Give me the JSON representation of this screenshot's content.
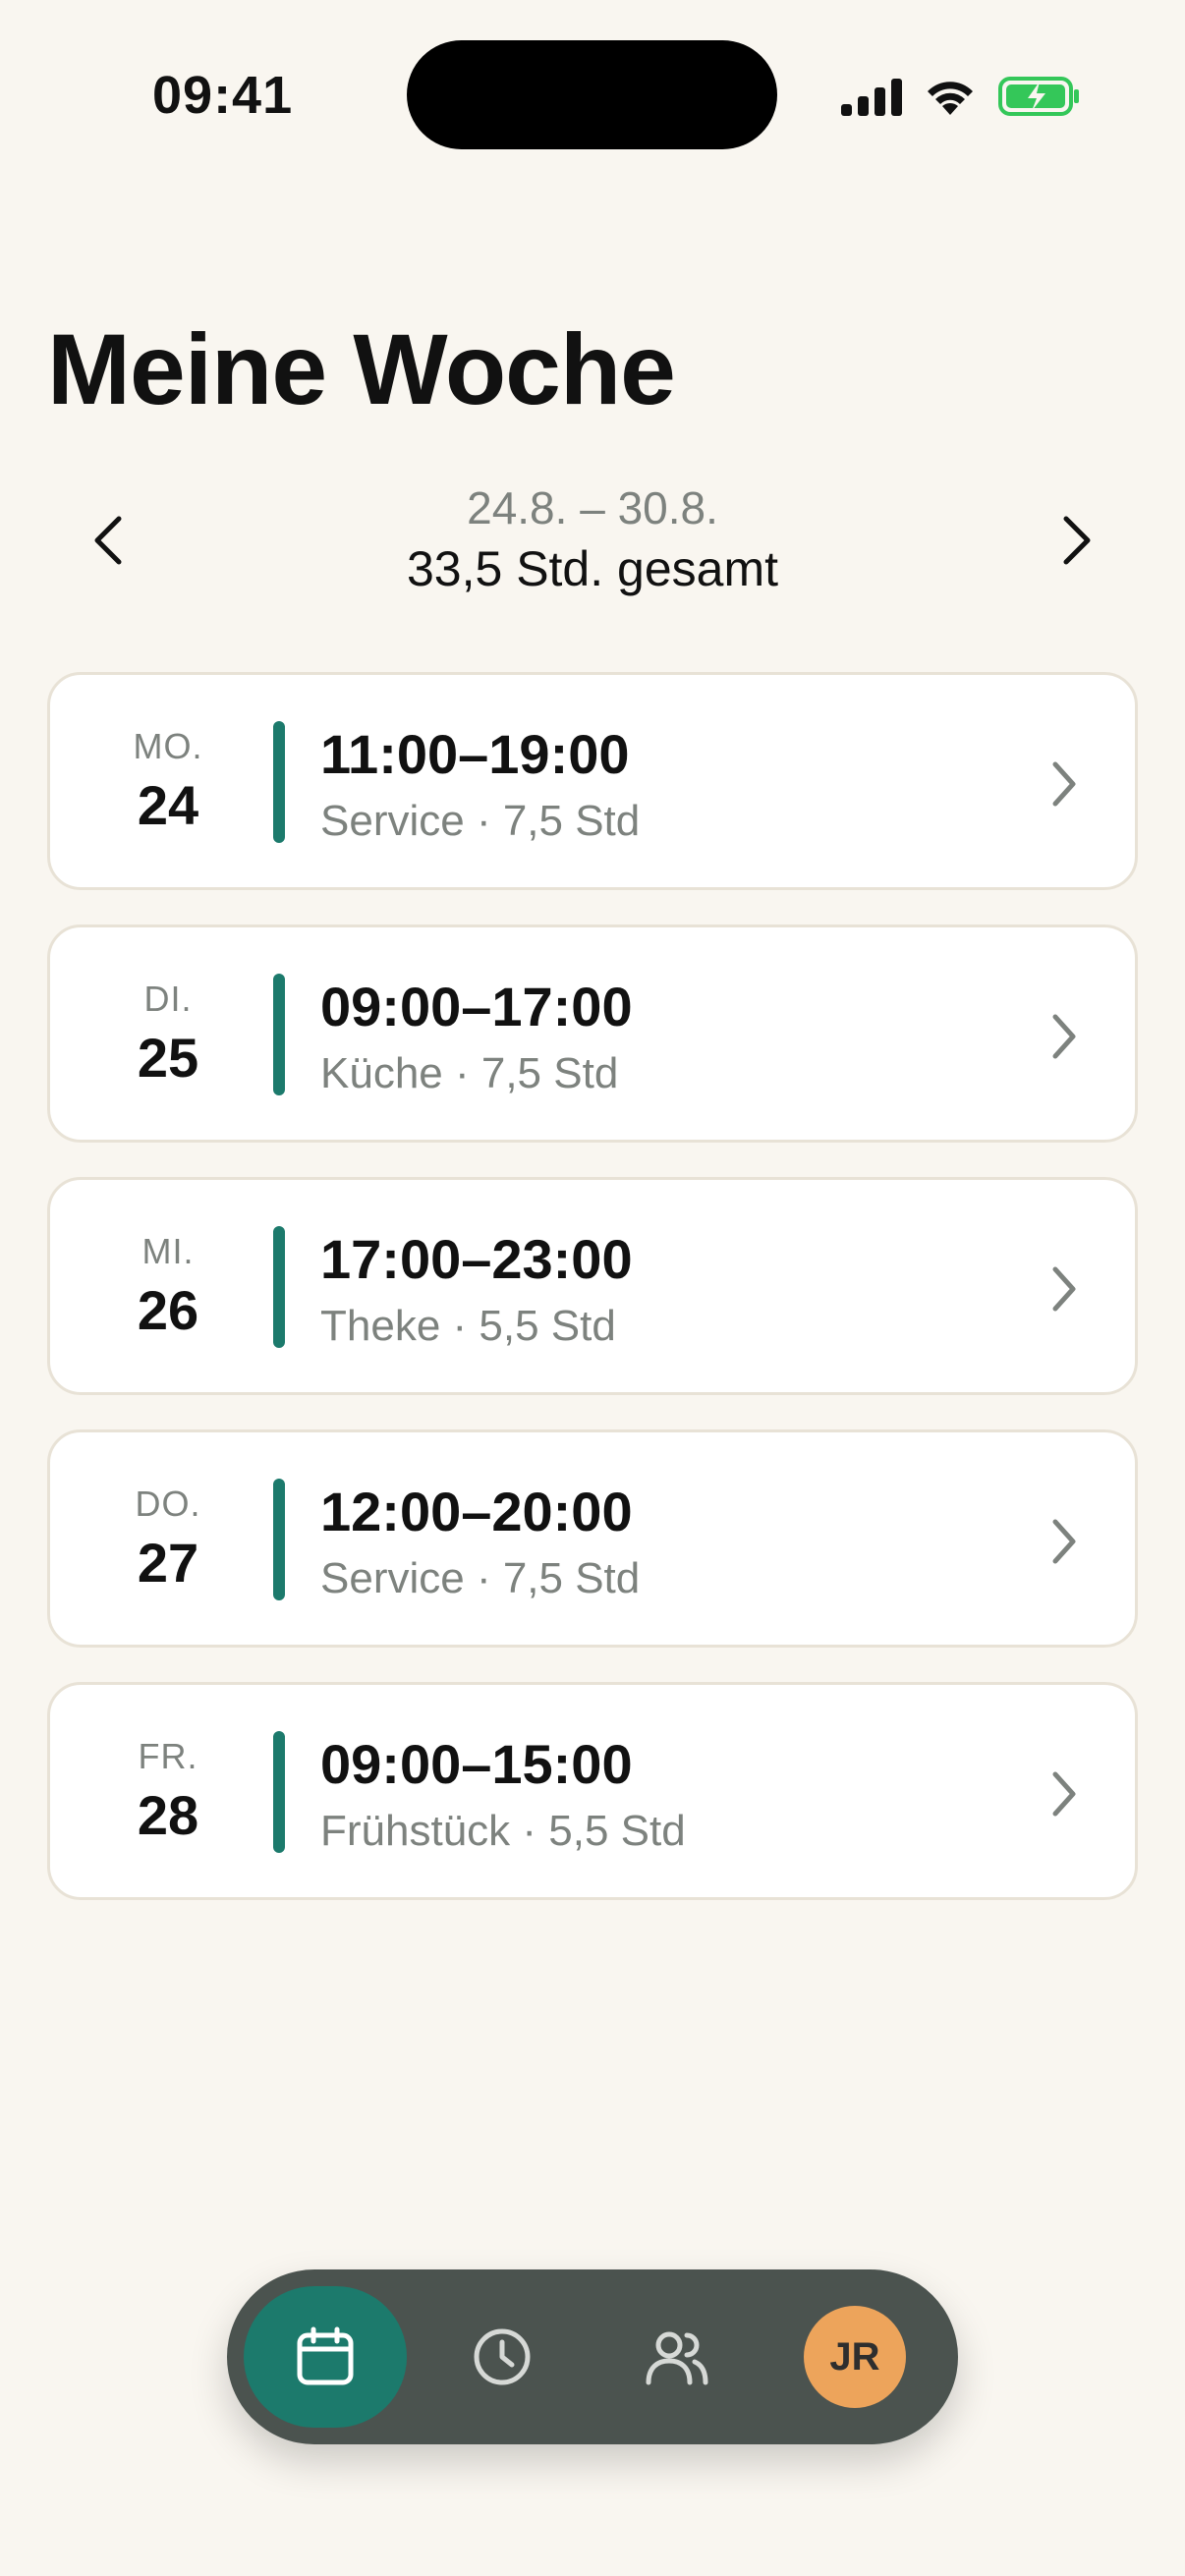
{
  "status_bar": {
    "time": "09:41"
  },
  "header": {
    "title": "Meine Woche"
  },
  "week": {
    "range": "24.8. – 30.8.",
    "total": "33,5 Std. gesamt"
  },
  "shifts": [
    {
      "weekday": "MO.",
      "date": "24",
      "time": "11:00–19:00",
      "meta": "Service · 7,5 Std"
    },
    {
      "weekday": "DI.",
      "date": "25",
      "time": "09:00–17:00",
      "meta": "Küche · 7,5 Std"
    },
    {
      "weekday": "MI.",
      "date": "26",
      "time": "17:00–23:00",
      "meta": "Theke · 5,5 Std"
    },
    {
      "weekday": "DO.",
      "date": "27",
      "time": "12:00–20:00",
      "meta": "Service · 7,5 Std"
    },
    {
      "weekday": "FR.",
      "date": "28",
      "time": "09:00–15:00",
      "meta": "Frühstück · 5,5 Std"
    }
  ],
  "tab_bar": {
    "items": [
      {
        "icon": "calendar-icon",
        "active": true
      },
      {
        "icon": "clock-icon",
        "active": false
      },
      {
        "icon": "users-icon",
        "active": false
      }
    ],
    "avatar_initials": "JR"
  },
  "colors": {
    "background": "#F9F6F0",
    "accent": "#1C7A6C",
    "tab_bar": "#4B534F",
    "avatar": "#EDA45B",
    "muted_text": "#7D827E",
    "battery": "#34C759"
  }
}
